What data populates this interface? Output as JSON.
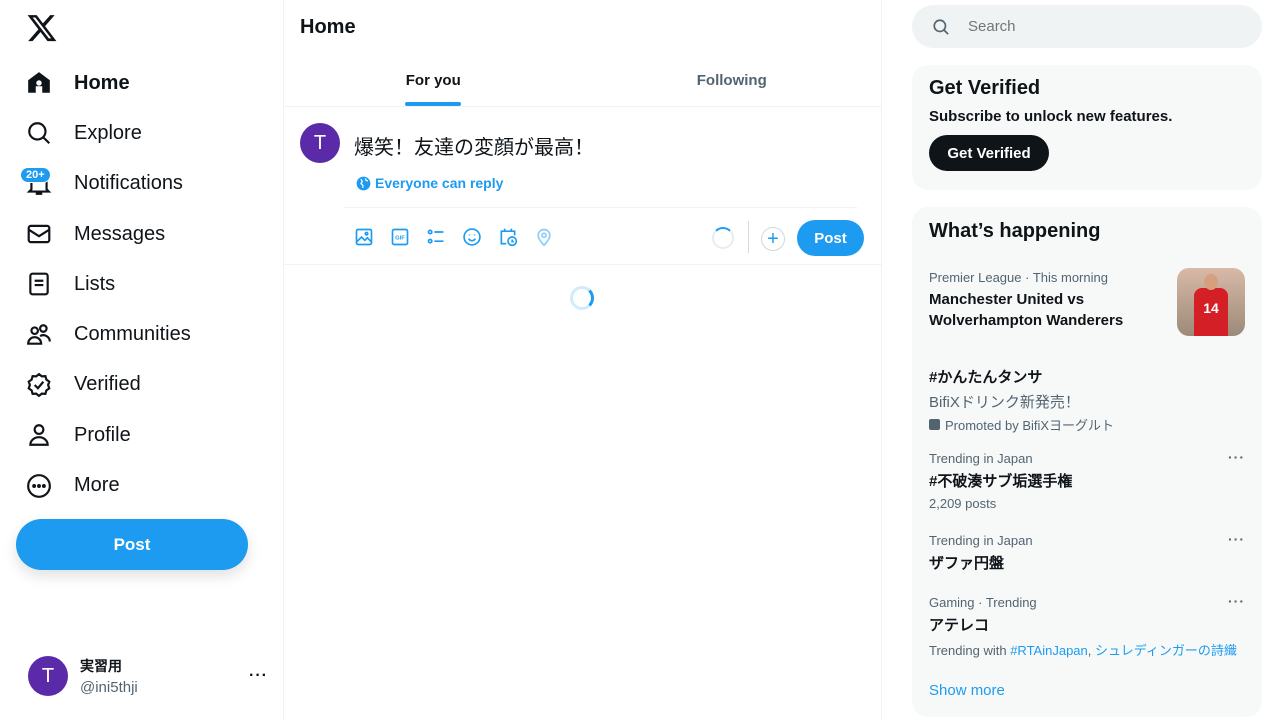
{
  "sidebar": {
    "items": [
      {
        "label": "Home",
        "icon": "home-icon"
      },
      {
        "label": "Explore",
        "icon": "search-icon"
      },
      {
        "label": "Notifications",
        "icon": "bell-icon",
        "badge": "20+"
      },
      {
        "label": "Messages",
        "icon": "envelope-icon"
      },
      {
        "label": "Lists",
        "icon": "list-icon"
      },
      {
        "label": "Communities",
        "icon": "people-icon"
      },
      {
        "label": "Verified",
        "icon": "verified-icon"
      },
      {
        "label": "Profile",
        "icon": "person-icon"
      },
      {
        "label": "More",
        "icon": "more-circle-icon"
      }
    ],
    "post_label": "Post",
    "account": {
      "initial": "T",
      "name": "実習用",
      "handle": "@ini5thji",
      "more": "···"
    }
  },
  "main": {
    "title": "Home",
    "tabs": [
      {
        "label": "For you"
      },
      {
        "label": "Following"
      }
    ],
    "composer": {
      "initial": "T",
      "text": "爆笑！友達の変顔が最高！",
      "reply": "Everyone can reply",
      "post_label": "Post",
      "plus": "+"
    }
  },
  "right": {
    "search_placeholder": "Search",
    "verified": {
      "title": "Get Verified",
      "subtitle": "Subscribe to unlock new features.",
      "button": "Get Verified"
    },
    "happening": {
      "title": "What’s happening",
      "sports": {
        "meta": "Premier League · This morning",
        "title": "Manchester United vs Wolverhampton Wanderers",
        "jersey": "14"
      },
      "promo": {
        "title": "#かんたんタンサ",
        "desc": "BifiXドリンク新発売！",
        "promoted": "Promoted by BifiXヨーグルト"
      },
      "trends": [
        {
          "meta": "Trending in Japan",
          "title": "#不破湊サブ垢選手権",
          "extra": "2,209 posts"
        },
        {
          "meta": "Trending in Japan",
          "title": "ザファ円盤"
        },
        {
          "meta": "Gaming · Trending",
          "title": "アテレコ",
          "with_label": "Trending with",
          "with_links": [
            "#RTAinJapan",
            "シュレディンガーの詩織"
          ]
        }
      ],
      "more": "···",
      "show_more": "Show more"
    }
  },
  "colors": {
    "accent": "#1d9bf0",
    "avatar": "#5b2aa8"
  }
}
